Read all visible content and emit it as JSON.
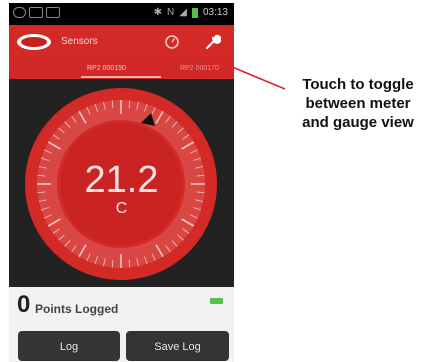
{
  "status_bar": {
    "time": "03:13",
    "icons": [
      "eye-icon",
      "image-icon",
      "photo-icon",
      "bluetooth-icon",
      "nfc-icon",
      "signal-icon",
      "battery-icon"
    ],
    "nfc_label": "N"
  },
  "action_bar": {
    "title": "Sensors",
    "background": "#d42a27",
    "icons": [
      "brand-logo",
      "gauge-toggle-icon",
      "wrench-icon"
    ]
  },
  "tabs": [
    {
      "label": "RP2 000150",
      "active": true
    },
    {
      "label": "RP2 000170",
      "active": false
    }
  ],
  "gauge": {
    "value": "21.2",
    "unit": "C",
    "ring_color": "#d32a27"
  },
  "log_panel": {
    "count": "0",
    "label": "Points Logged",
    "buttons": {
      "log": "Log",
      "save": "Save Log"
    }
  },
  "annotation": {
    "lines": [
      "Touch to toggle",
      "between meter",
      "and gauge view"
    ],
    "line_color": "#e0222a"
  }
}
